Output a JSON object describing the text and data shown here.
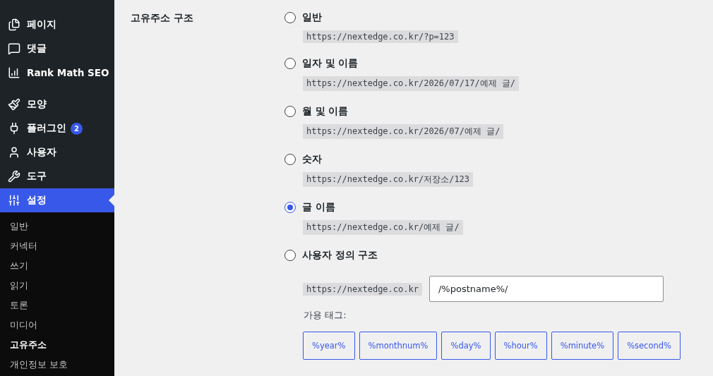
{
  "sidebar": {
    "menu": [
      {
        "label": "페이지",
        "selected": false
      },
      {
        "label": "댓글",
        "selected": false
      },
      {
        "label": "Rank Math SEO",
        "selected": false
      },
      {
        "label": "모양",
        "selected": false
      },
      {
        "label": "플러그인",
        "selected": false,
        "badge": "2"
      },
      {
        "label": "사용자",
        "selected": false
      },
      {
        "label": "도구",
        "selected": false
      },
      {
        "label": "설정",
        "selected": true
      }
    ],
    "submenu": [
      {
        "label": "일반",
        "selected": false
      },
      {
        "label": "커넥터",
        "selected": false
      },
      {
        "label": "쓰기",
        "selected": false
      },
      {
        "label": "읽기",
        "selected": false
      },
      {
        "label": "토론",
        "selected": false
      },
      {
        "label": "미디어",
        "selected": false
      },
      {
        "label": "고유주소",
        "selected": true
      },
      {
        "label": "개인정보 보호",
        "selected": false
      }
    ]
  },
  "permalink": {
    "label": "고유주소 구조",
    "options": [
      {
        "label": "일반",
        "selected": false,
        "example": "https://nextedge.co.kr/?p=123"
      },
      {
        "label": "일자 및 이름",
        "selected": false,
        "example": "https://nextedge.co.kr/2026/07/17/예제 글/"
      },
      {
        "label": "월 및 이름",
        "selected": false,
        "example": "https://nextedge.co.kr/2026/07/예제 글/"
      },
      {
        "label": "숫자",
        "selected": false,
        "example": "https://nextedge.co.kr/저장소/123"
      },
      {
        "label": "글 이름",
        "selected": true,
        "example": "https://nextedge.co.kr/예제 글/"
      },
      {
        "label": "사용자 정의 구조",
        "selected": false
      }
    ],
    "custom": {
      "prefix": "https://nextedge.co.kr",
      "value": "/%postname%/"
    },
    "tags_label": "가용 태그:",
    "tags": [
      "%year%",
      "%monthnum%",
      "%day%",
      "%hour%",
      "%minute%",
      "%second%"
    ]
  }
}
